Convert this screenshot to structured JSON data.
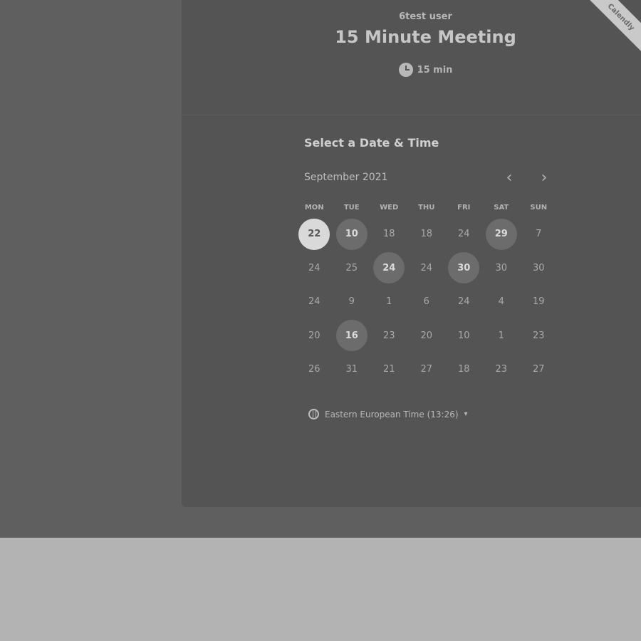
{
  "header": {
    "host_name": "6test user",
    "event_title": "15 Minute Meeting",
    "duration": "15 min",
    "ribbon_text": "Calendly"
  },
  "scheduler": {
    "section_title": "Select a Date & Time",
    "month_label": "September 2021",
    "prev_icon": "chevron-left-icon",
    "next_icon": "chevron-right-icon",
    "prev_glyph": "‹",
    "next_glyph": "›",
    "weekdays": [
      "MON",
      "TUE",
      "WED",
      "THU",
      "FRI",
      "SAT",
      "SUN"
    ],
    "weeks": [
      [
        {
          "d": "22",
          "s": "selected"
        },
        {
          "d": "10",
          "s": "avail"
        },
        {
          "d": "18",
          "s": "off"
        },
        {
          "d": "18",
          "s": "off"
        },
        {
          "d": "24",
          "s": "off"
        },
        {
          "d": "29",
          "s": "avail"
        },
        {
          "d": "7",
          "s": "off"
        }
      ],
      [
        {
          "d": "24",
          "s": "off"
        },
        {
          "d": "25",
          "s": "off"
        },
        {
          "d": "24",
          "s": "avail"
        },
        {
          "d": "24",
          "s": "off"
        },
        {
          "d": "30",
          "s": "avail"
        },
        {
          "d": "30",
          "s": "off"
        },
        {
          "d": "30",
          "s": "off"
        }
      ],
      [
        {
          "d": "24",
          "s": "off"
        },
        {
          "d": "9",
          "s": "off"
        },
        {
          "d": "1",
          "s": "off"
        },
        {
          "d": "6",
          "s": "off"
        },
        {
          "d": "24",
          "s": "off"
        },
        {
          "d": "4",
          "s": "off"
        },
        {
          "d": "19",
          "s": "off"
        }
      ],
      [
        {
          "d": "20",
          "s": "off"
        },
        {
          "d": "16",
          "s": "avail"
        },
        {
          "d": "23",
          "s": "off"
        },
        {
          "d": "20",
          "s": "off"
        },
        {
          "d": "10",
          "s": "off"
        },
        {
          "d": "1",
          "s": "off"
        },
        {
          "d": "23",
          "s": "off"
        }
      ],
      [
        {
          "d": "26",
          "s": "off"
        },
        {
          "d": "31",
          "s": "off"
        },
        {
          "d": "21",
          "s": "off"
        },
        {
          "d": "27",
          "s": "off"
        },
        {
          "d": "18",
          "s": "off"
        },
        {
          "d": "23",
          "s": "off"
        },
        {
          "d": "27",
          "s": "off"
        }
      ]
    ]
  },
  "timezone": {
    "icon": "globe-icon",
    "label": "Eastern European Time (13:26)",
    "caret": "▾"
  },
  "colors": {
    "page_background": "#5f5f5f",
    "card_background": "#545454",
    "footer_background": "#b3b3b3",
    "available_day": "#6c6c6c",
    "selected_day": "#d9d9d9"
  }
}
